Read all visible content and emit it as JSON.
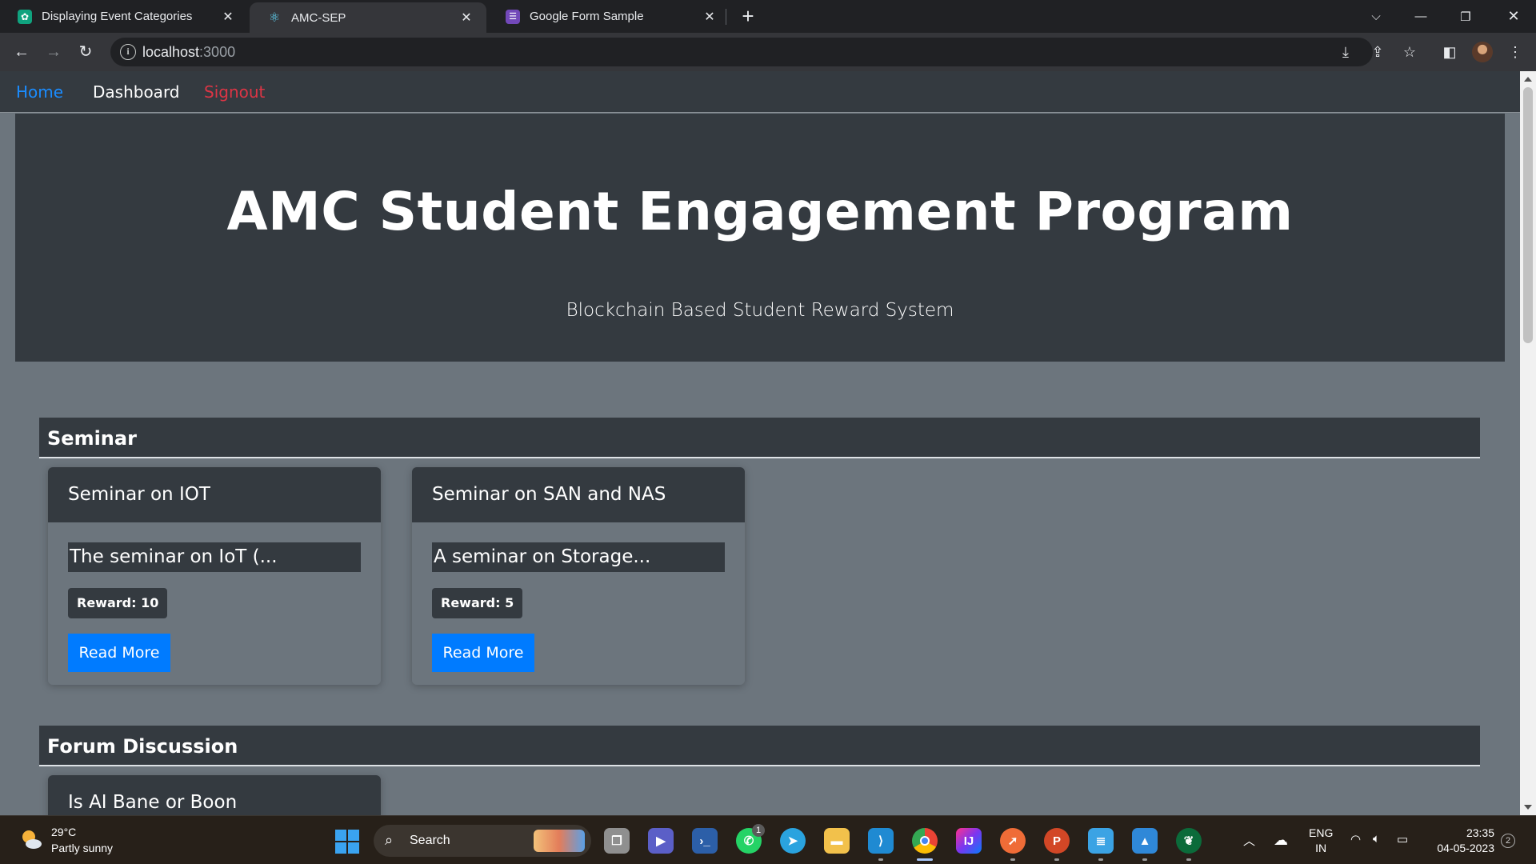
{
  "browser": {
    "tabs": [
      {
        "title": "Displaying Event Categories",
        "icon": "openai-icon"
      },
      {
        "title": "AMC-SEP",
        "icon": "react-icon"
      },
      {
        "title": "Google Form Sample",
        "icon": "google-forms-icon"
      }
    ],
    "active_tab": 1,
    "url_host": "localhost",
    "url_port": ":3000"
  },
  "navbar": {
    "home": "Home",
    "dashboard": "Dashboard",
    "signout": "Signout"
  },
  "hero": {
    "title": "AMC Student Engagement Program",
    "subtitle": "Blockchain Based Student Reward System"
  },
  "sections": [
    {
      "title": "Seminar",
      "cards": [
        {
          "title": "Seminar on IOT",
          "description": "The seminar on IoT (...",
          "reward": "Reward: 10",
          "button": "Read More"
        },
        {
          "title": "Seminar on SAN and NAS",
          "description": "A seminar on Storage...",
          "reward": "Reward: 5",
          "button": "Read More"
        }
      ]
    },
    {
      "title": "Forum Discussion",
      "cards": [
        {
          "title": "Is AI Bane or Boon"
        }
      ]
    }
  ],
  "colors": {
    "page_bg": "#6c757d",
    "dark": "#343a40",
    "primary": "#007bff",
    "link": "#1a8cff",
    "danger": "#dc3545"
  },
  "taskbar": {
    "weather_temp": "29°C",
    "weather_desc": "Partly sunny",
    "search_label": "Search",
    "whatsapp_badge": "1",
    "lang_line1": "ENG",
    "lang_line2": "IN",
    "time": "23:35",
    "date": "04-05-2023",
    "notification_count": "2"
  }
}
